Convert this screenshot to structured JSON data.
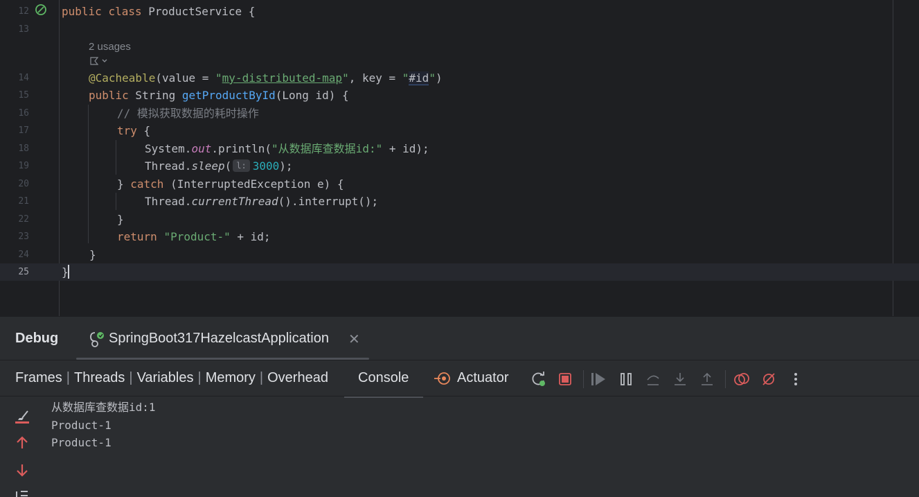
{
  "editor": {
    "lines": [
      {
        "n": "12"
      },
      {
        "n": "13"
      },
      {
        "n": "14"
      },
      {
        "n": "15"
      },
      {
        "n": "16"
      },
      {
        "n": "17"
      },
      {
        "n": "18"
      },
      {
        "n": "19"
      },
      {
        "n": "20"
      },
      {
        "n": "21"
      },
      {
        "n": "22"
      },
      {
        "n": "23"
      },
      {
        "n": "24"
      },
      {
        "n": "25"
      }
    ],
    "usages_hint": "2 usages",
    "code": {
      "l12_kw1": "public",
      "l12_kw2": "class",
      "l12_rest": " ProductService {",
      "l14_ann": "@Cacheable",
      "l14_a": "(value = ",
      "l14_q1": "\"",
      "l14_map": "my-distributed-map",
      "l14_q2": "\"",
      "l14_b": ", key = ",
      "l14_q3": "\"",
      "l14_id": "#id",
      "l14_q4": "\"",
      "l14_c": ")",
      "l15_kw": "public",
      "l15_a": " String ",
      "l15_fn": "getProductById",
      "l15_b": "(Long id) {",
      "l16_cmt": "// 模拟获取数据的耗时操作",
      "l17_kw": "try",
      "l17_b": " {",
      "l18_a": "System.",
      "l18_field": "out",
      "l18_b": ".println(",
      "l18_str": "\"从数据库查数据id:\"",
      "l18_c": " + id);",
      "l19_a": "Thread.",
      "l19_fn": "sleep",
      "l19_b": "(",
      "l19_hint": "l:",
      "l19_num": "3000",
      "l19_c": ");",
      "l20_a": "} ",
      "l20_kw": "catch",
      "l20_b": " (InterruptedException e) {",
      "l21_a": "Thread.",
      "l21_fn": "currentThread",
      "l21_b": "().interrupt();",
      "l22": "}",
      "l23_kw": "return",
      "l23_sp": " ",
      "l23_str": "\"Product-\"",
      "l23_b": " + id;",
      "l24": "}",
      "l25": "}"
    }
  },
  "debug": {
    "title": "Debug",
    "run_config": "SpringBoot317HazelcastApplication",
    "tabs": [
      "Frames",
      "Threads",
      "Variables",
      "Memory",
      "Overhead"
    ],
    "console_tab": "Console",
    "actuator_tab": "Actuator",
    "toolbar_icons": [
      "rerun-icon",
      "stop-icon",
      "resume-icon",
      "pause-icon",
      "step-over-icon",
      "step-into-icon",
      "step-out-icon",
      "view-breakpoints-icon",
      "mute-breakpoints-icon",
      "more-icon"
    ],
    "console_lines": [
      "从数据库查数据id:1",
      "Product-1",
      "Product-1"
    ],
    "colors": {
      "accent_red": "#db5c5c",
      "string_green": "#6aab73",
      "keyword_orange": "#cf8e6d"
    }
  }
}
